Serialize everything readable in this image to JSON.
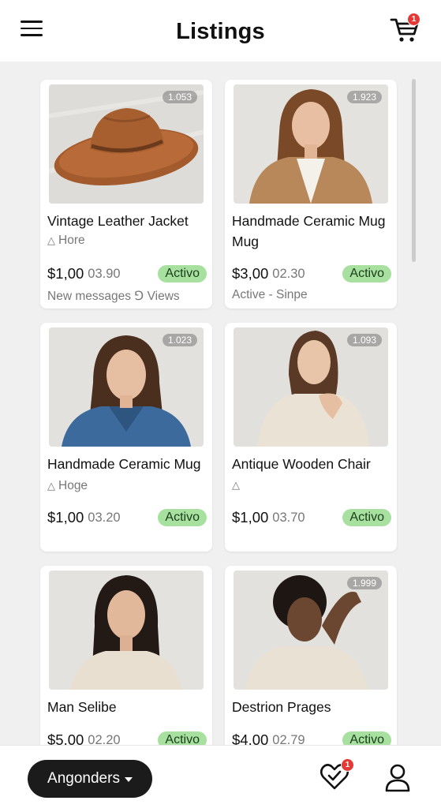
{
  "header": {
    "title": "Listings",
    "cart_badge": "1"
  },
  "listings": [
    {
      "title": "Vintage Leather Jacket",
      "count": "1.053",
      "sub": "Hore",
      "price": "$1,00",
      "old_price": "03.90",
      "status": "Activo",
      "footer": "New messages ⅁ Views"
    },
    {
      "title": "Handmade Ceramic Mug Mug",
      "count": "1.923",
      "sub": "",
      "price": "$3,00",
      "old_price": "02.30",
      "status": "Activo",
      "footer": "Active - Sinpe"
    },
    {
      "title": "Handmade Ceramic Mug",
      "count": "1.023",
      "sub": "Hoge",
      "price": "$1,00",
      "old_price": "03.20",
      "status": "Activo",
      "footer": ""
    },
    {
      "title": "Antique Wooden Chair",
      "count": "1.093",
      "sub": "",
      "price": "$1,00",
      "old_price": "03.70",
      "status": "Activo",
      "footer": ""
    },
    {
      "title": "Man Selibe",
      "count": "",
      "sub": "",
      "price": "$5,00",
      "old_price": "02.20",
      "status": "Activo",
      "footer": ""
    },
    {
      "title": "Destrion Prages",
      "count": "1.999",
      "sub": "",
      "price": "$4.00",
      "old_price": "02.79",
      "status": "Activo",
      "footer": ""
    }
  ],
  "bottom": {
    "dropdown_label": "Angonders",
    "favorites_badge": "1"
  },
  "icons": {
    "menu": "hamburger-icon",
    "cart": "cart-icon",
    "favorites": "heart-check-icon",
    "profile": "user-icon",
    "dropdown": "caret-down-icon"
  },
  "colors": {
    "status_bg": "#a8e0a0",
    "badge": "#e53935",
    "dropdown_bg": "#1b1b1b"
  }
}
